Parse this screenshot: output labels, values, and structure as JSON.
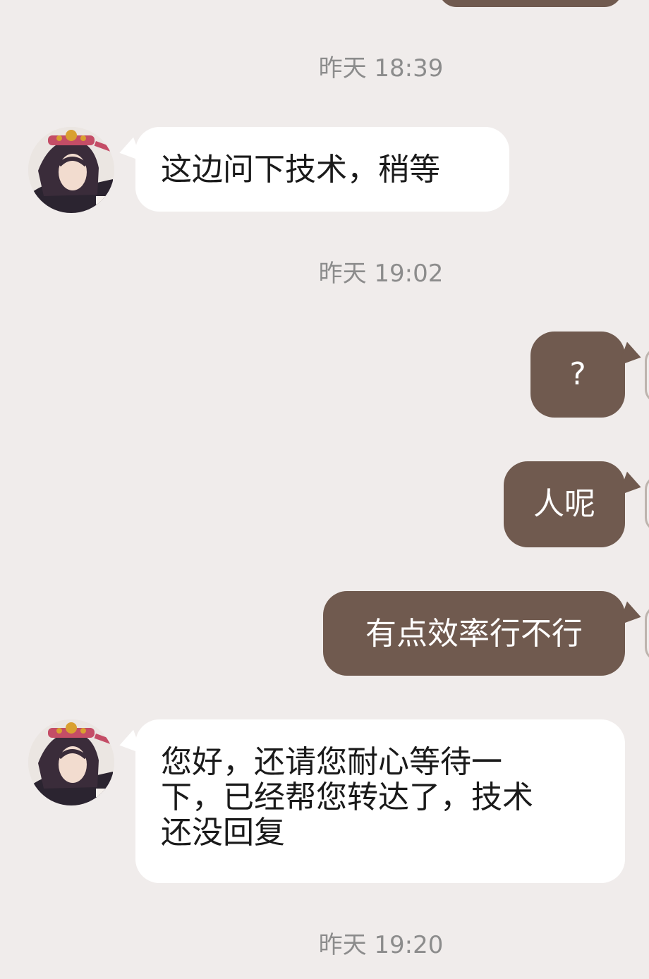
{
  "timestamps": [
    "昨天 18:39",
    "昨天 19:02",
    "昨天 19:20"
  ],
  "messages": [
    {
      "side": "in",
      "text": "这边问下技术，稍等"
    },
    {
      "side": "out",
      "text": "?"
    },
    {
      "side": "out",
      "text": "人呢"
    },
    {
      "side": "out",
      "text": "有点效率行不行"
    },
    {
      "side": "in",
      "lines": [
        "您好，还请您耐心等待一",
        "下，已经帮您转达了，技术",
        "还没回复"
      ]
    }
  ],
  "colors": {
    "background": "#f0eceb",
    "incoming_bubble": "#ffffff",
    "outgoing_bubble": "#705a4f",
    "timestamp_text": "#8c8c8c"
  }
}
